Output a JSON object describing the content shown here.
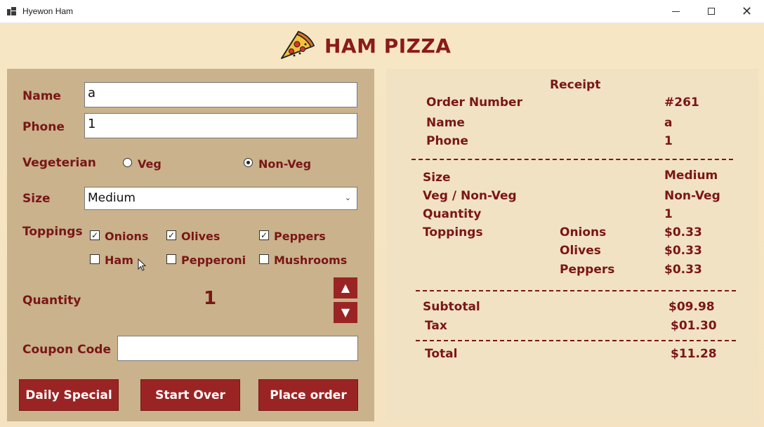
{
  "window": {
    "title": "Hyewon Ham",
    "close_glyph": "✕"
  },
  "header": {
    "brand_name": "HAM PIZZA",
    "logo_icon": "pizza-slice-icon"
  },
  "order_form": {
    "name_label": "Name",
    "name_value": "a",
    "phone_label": "Phone",
    "phone_value": "1",
    "veg_label": "Vegeterian",
    "veg_option": "Veg",
    "nonveg_option": "Non-Veg",
    "selected_diet": "Non-Veg",
    "size_label": "Size",
    "size_value": "Medium",
    "toppings_label": "Toppings",
    "toppings": [
      {
        "label": "Onions",
        "checked": true
      },
      {
        "label": "Olives",
        "checked": true
      },
      {
        "label": "Peppers",
        "checked": true
      },
      {
        "label": "Ham",
        "checked": false
      },
      {
        "label": "Pepperoni",
        "checked": false
      },
      {
        "label": "Mushrooms",
        "checked": false
      }
    ],
    "quantity_label": "Quantity",
    "quantity_value": "1",
    "spin_up": "▲",
    "spin_down": "▼",
    "coupon_label": "Coupon Code",
    "coupon_value": "",
    "buttons": {
      "daily_special": "Daily Special",
      "start_over": "Start Over",
      "place_order": "Place order"
    }
  },
  "receipt": {
    "title": "Receipt",
    "order_number_label": "Order Number",
    "order_number": "#261",
    "name_label": "Name",
    "name_value": "a",
    "phone_label": "Phone",
    "phone_value": "1",
    "size_label": "Size",
    "size_value": "Medium",
    "diet_label": "Veg / Non-Veg",
    "diet_value": "Non-Veg",
    "quantity_label": "Quantity",
    "quantity_value": "1",
    "toppings_label": "Toppings",
    "toppings": [
      {
        "name": "Onions",
        "price": "$0.33"
      },
      {
        "name": "Olives",
        "price": "$0.33"
      },
      {
        "name": "Peppers",
        "price": "$0.33"
      }
    ],
    "subtotal_label": "Subtotal",
    "subtotal": "$09.98",
    "tax_label": "Tax",
    "tax": "$01.30",
    "total_label": "Total",
    "total": "$11.28"
  },
  "colors": {
    "accent": "#9a2424",
    "text_accent": "#7a1616",
    "left_panel": "#c9b28c",
    "receipt_bg": "#f2e2c4",
    "page_bg": "#f6e7c9"
  }
}
